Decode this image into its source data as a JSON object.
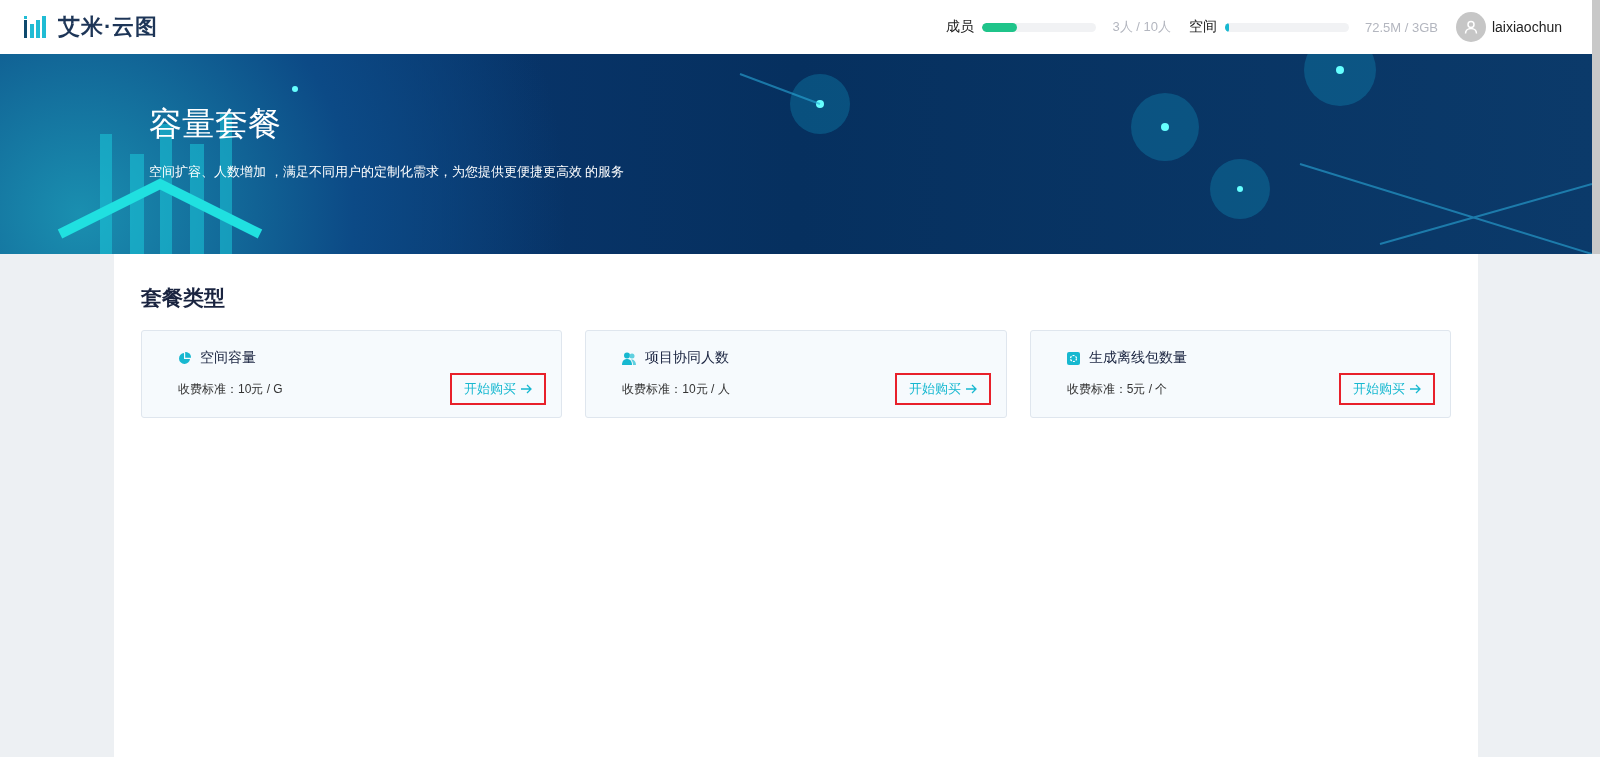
{
  "header": {
    "logo_text": "艾米·云图",
    "meters": [
      {
        "label": "成员",
        "level": 0.3,
        "color": "#1fc48a",
        "reading": "3人 / 10人"
      },
      {
        "label": "空间",
        "level": 0.02,
        "color": "#17b8d0",
        "reading": "72.5M / 3GB"
      }
    ],
    "user": {
      "name": "laixiaochun"
    }
  },
  "banner": {
    "title": "容量套餐",
    "subtitle": "空间扩容、人数增加 ，满足不同用户的定制化需求，为您提供更便捷更高效 的服务"
  },
  "section": {
    "title": "套餐类型",
    "plans": [
      {
        "kind": "storage",
        "name": "空间容量",
        "price": "收费标准：10元 / G",
        "button": "开始购买"
      },
      {
        "kind": "members",
        "name": "项目协同人数",
        "price": "收费标准：10元 / 人",
        "button": "开始购买"
      },
      {
        "kind": "offline",
        "name": "生成离线包数量",
        "price": "收费标准：5元 / 个",
        "button": "开始购买"
      }
    ]
  }
}
